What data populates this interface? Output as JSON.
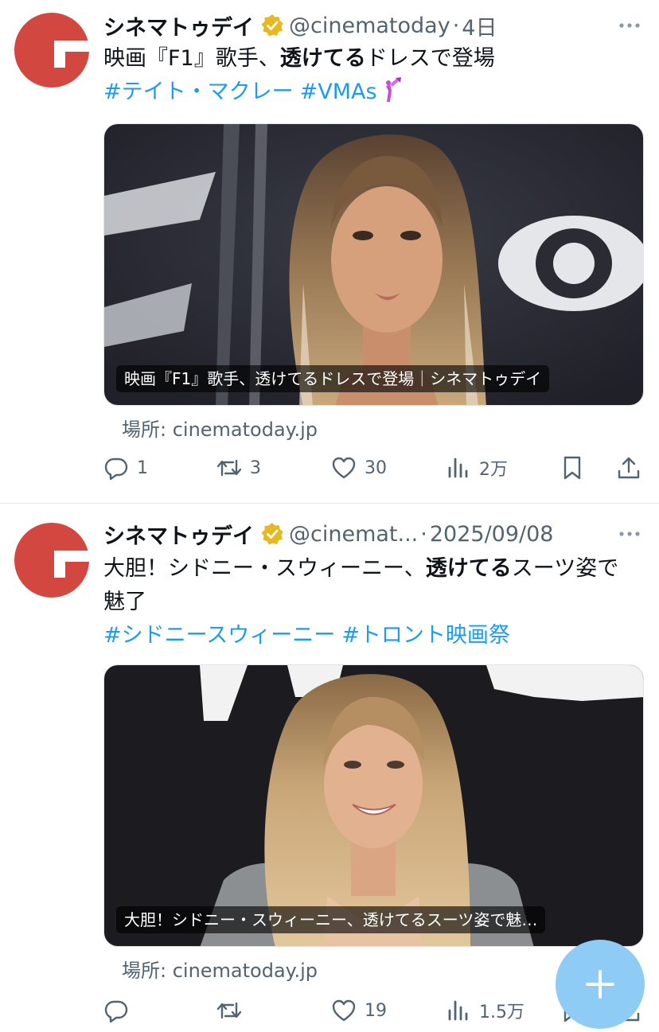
{
  "tweets": [
    {
      "display_name": "シネマトゥデイ",
      "handle": "@cinematoday",
      "separator": "·",
      "time": "4日",
      "text_before": "映画『F1』歌手、",
      "text_bold": "透けてる",
      "text_after": "ドレスで登場",
      "hashtags": [
        "#テイト・マクレー",
        "#VMAs"
      ],
      "card_caption": "映画『F1』歌手、透けてるドレスで登場｜シネマトゥデイ",
      "source": "場所: cinematoday.jp",
      "replies": "1",
      "retweets": "3",
      "likes": "30",
      "views": "2万"
    },
    {
      "display_name": "シネマトゥデイ",
      "handle": "@cinemat...",
      "separator": "·",
      "time": "2025/09/08",
      "text_before": "大胆！シドニー・スウィーニー、",
      "text_bold": "透けてる",
      "text_after": "スーツ姿で魅了",
      "hashtags": [
        "#シドニースウィーニー",
        "#トロント映画祭"
      ],
      "card_caption": "大胆！シドニー・スウィーニー、透けてるスーツ姿で魅…",
      "source": "場所: cinematoday.jp",
      "replies": "",
      "retweets": "",
      "likes": "19",
      "views": "1.5万"
    }
  ],
  "colors": {
    "link": "#1d9bf0",
    "secondary_text": "#536471",
    "avatar_red": "#d2473f",
    "verified_gold": "#e8b820",
    "fab": "#8ecbf5"
  },
  "icons": [
    "cinematoday-logo",
    "verified-badge-icon",
    "more-icon",
    "reply-icon",
    "retweet-icon",
    "like-icon",
    "views-icon",
    "bookmark-icon",
    "share-icon",
    "compose-icon",
    "vma-moonman-emoji"
  ]
}
